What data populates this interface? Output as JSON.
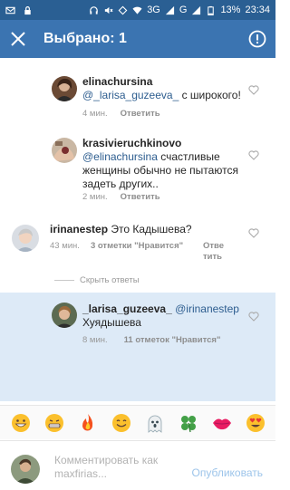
{
  "status_bar": {
    "signal": "3G",
    "network_letter": "G",
    "battery": "13%",
    "time": "23:34"
  },
  "header": {
    "title": "Выбрано: 1"
  },
  "comments": [
    {
      "username": "elinachursina",
      "mention": "@_larisa_guzeeva_",
      "text": "с широкого!",
      "time": "4 мин.",
      "reply_label": "Ответить"
    },
    {
      "username": "krasivieruchkinovo",
      "mention": "@elinachursina",
      "text": "счастливые женщины обычно не пытаются задеть других..",
      "time": "2 мин.",
      "reply_label": "Ответить"
    },
    {
      "username": "irinanestep",
      "text": "Это Кадышева?",
      "time": "43 мин.",
      "likes": "3 отметки \"Нравится\"",
      "reply_label_1": "Отве",
      "reply_label_2": "тить"
    },
    {
      "username": "_larisa_guzeeva_",
      "mention": "@irinanestep",
      "text": "Хуядышева",
      "time": "8 мин.",
      "likes": "11 отметок \"Нравится\""
    }
  ],
  "hide_replies": "Скрыть ответы",
  "emoji_bar": [
    "grinning-face",
    "grinning-teeth-face",
    "fire",
    "happy-face",
    "ghost",
    "four-leaf-clover",
    "lips",
    "heart-eyes-face"
  ],
  "comment_input": {
    "placeholder_1": "Комментировать как",
    "placeholder_2": "maxfirias...",
    "publish": "Опубликовать"
  },
  "colors": {
    "header": "#3b74b1",
    "status_bar": "#2a5f93",
    "selected_bg": "#ddeaf7",
    "mention": "#2d5d8f"
  }
}
